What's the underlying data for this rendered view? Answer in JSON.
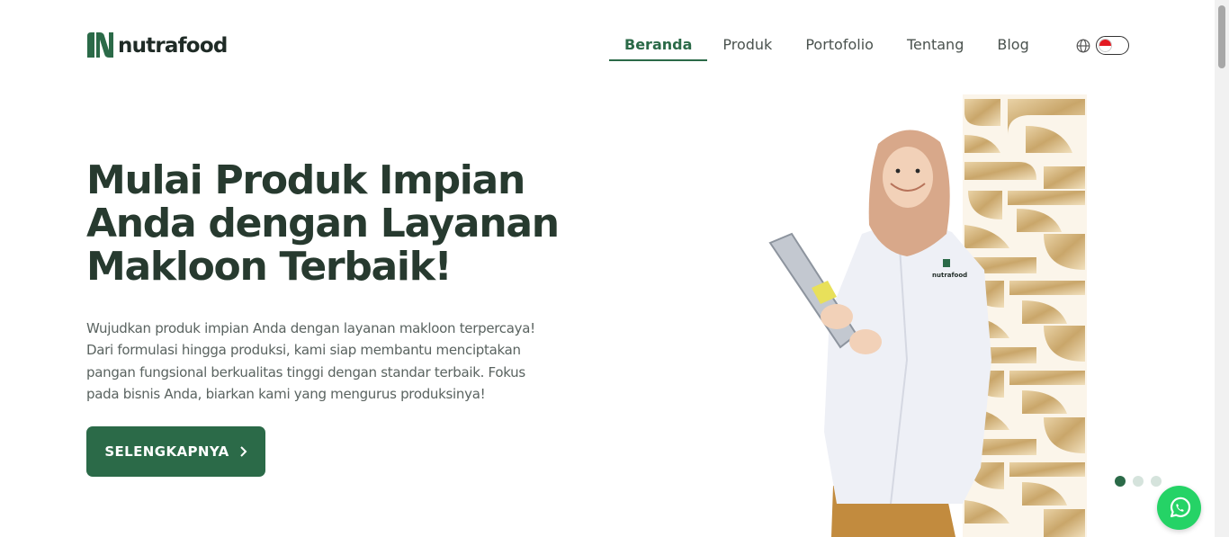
{
  "brand": {
    "name": "nutrafood",
    "accent": "#2b6a48",
    "whatsapp_color": "#25d366"
  },
  "nav": {
    "items": [
      {
        "label": "Beranda",
        "active": true
      },
      {
        "label": "Produk"
      },
      {
        "label": "Portofolio"
      },
      {
        "label": "Tentang"
      },
      {
        "label": "Blog"
      }
    ],
    "language_icon": "globe-icon",
    "language_flag": "indonesia-flag"
  },
  "hero": {
    "title_lines": [
      "Mulai Produk Impian",
      "Anda dengan Layanan",
      "Makloon Terbaik!"
    ],
    "description_lines": [
      "Wujudkan produk impian Anda dengan layanan makloon terpercaya!",
      "Dari formulasi hingga produksi, kami siap membantu menciptakan",
      "pangan fungsional berkualitas tinggi dengan standar terbaik. Fokus",
      "pada bisnis Anda, biarkan kami yang mengurus produksinya!"
    ],
    "cta_label": "SELENGKAPNYA",
    "cta_icon": "chevron-right-icon",
    "image_alt": "woman in lab coat holding clipboard in front of golden batik pattern",
    "coat_logo_text": "nutrafood"
  },
  "carousel": {
    "slide_count": 3,
    "active_index": 0
  },
  "floating": {
    "whatsapp_icon": "whatsapp-icon"
  }
}
